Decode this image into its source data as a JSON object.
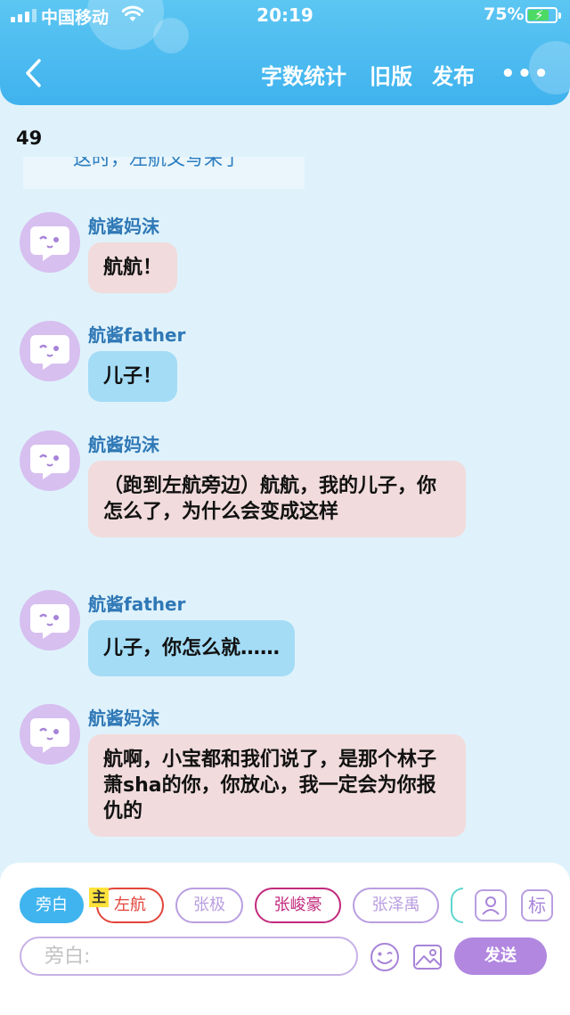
{
  "status": {
    "carrier": "中国移动",
    "time": "20:19",
    "battery": "75%",
    "battery_level": 0.75,
    "battery_color": "#4cd964"
  },
  "nav": {
    "back_icon": "chevron-left-icon",
    "actions": [
      "字数统计",
      "旧版",
      "发布"
    ],
    "more": "•••"
  },
  "word_count": "49",
  "clipped_text": "这时，左航又写来了",
  "messages": [
    {
      "sender": "航酱妈沫",
      "text": "航航！",
      "role": "mom"
    },
    {
      "sender": "航酱father",
      "text": "儿子！",
      "role": "dad"
    },
    {
      "sender": "航酱妈沫",
      "text": "（跑到左航旁边）航航，我的儿子，你怎么了，为什么会变成这样",
      "role": "mom"
    },
    {
      "sender": "航酱father",
      "text": "儿子，你怎么就……",
      "role": "dad"
    },
    {
      "sender": "航酱妈沫",
      "text": "航啊，小宝都和我们说了，是那个林子萧sha的你，你放心，我一定会为你报仇的",
      "role": "mom"
    }
  ],
  "colors": {
    "header": "#3fb2ee",
    "mom_bubble": "#f1dbdc",
    "dad_bubble": "#a4dcf6",
    "accent_purple": "#b187e0"
  },
  "chips": [
    {
      "label": "旁白",
      "color": "#3fb4ef"
    },
    {
      "label": "左航",
      "color": "#e2453b"
    },
    {
      "label": "张极",
      "color": "#b99ee0"
    },
    {
      "label": "张峻豪",
      "color": "#c22a7d"
    },
    {
      "label": "张泽禹",
      "color": "#b99ee0"
    }
  ],
  "host_tag": "主",
  "tools": {
    "label_tool": "标"
  },
  "input": {
    "placeholder": "旁白:"
  },
  "send_label": "发送"
}
